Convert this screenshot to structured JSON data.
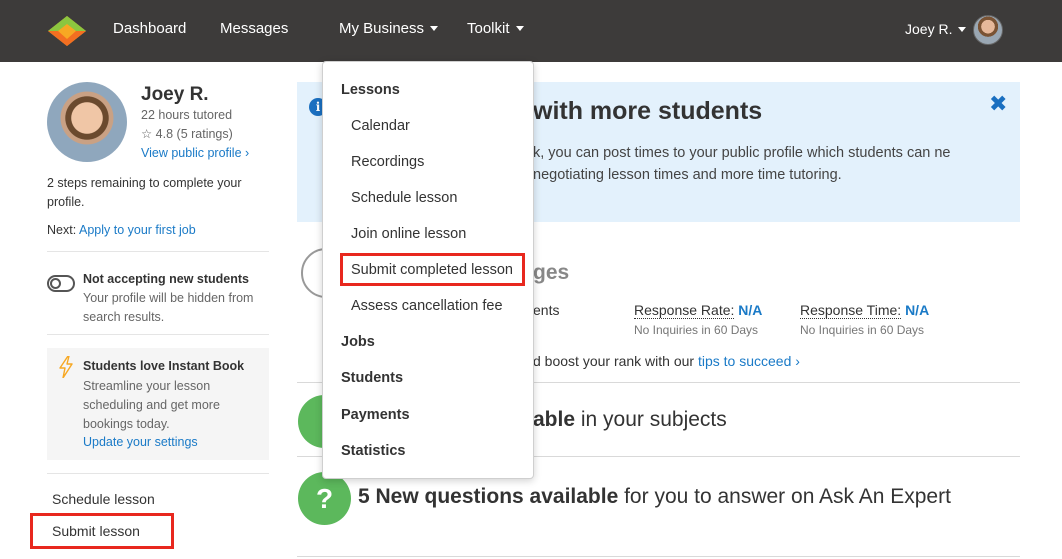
{
  "nav": {
    "items": [
      "Dashboard",
      "Messages",
      "My Business",
      "Toolkit"
    ],
    "user": "Joey R.",
    "bg_color": "#3d3b3a"
  },
  "profile": {
    "name": "Joey R.",
    "hours": "22 hours tutored",
    "rating": "☆ 4.8 (5 ratings)",
    "view_link": "View public profile ›",
    "steps": "2 steps remaining to complete your profile.",
    "next_label": "Next:",
    "next_link": "Apply to your first job"
  },
  "availability": {
    "title": "Not accepting new students",
    "subtitle": "Your profile will be hidden from search results."
  },
  "instant_book": {
    "title": "Students love Instant Book",
    "text": "Streamline your lesson scheduling and get more bookings today.",
    "link": "Update your settings"
  },
  "sidebar_links": [
    "Schedule lesson",
    "Submit lesson"
  ],
  "banner": {
    "title": "with more students",
    "text": "k, you can post times to your public profile which students can ne negotiating lesson times and more time tutoring.",
    "close": "✖"
  },
  "messages": {
    "title": "ges",
    "partial_label": "ents",
    "response_rate_label": "Response Rate:",
    "response_rate_value": "N/A",
    "response_rate_sub": "No Inquiries in 60 Days",
    "response_time_label": "Response Time:",
    "response_time_value": "N/A",
    "response_time_sub": "No Inquiries in 60 Days",
    "boost_text": "d boost your rank with our ",
    "boost_link": "tips to succeed ›"
  },
  "jobs": {
    "bold": "able",
    "rest": " in your subjects"
  },
  "questions": {
    "bold": "5 New questions available",
    "rest": " for you to answer on Ask An Expert",
    "icon": "?"
  },
  "dropdown": {
    "lessons_header": "Lessons",
    "lesson_items": [
      "Calendar",
      "Recordings",
      "Schedule lesson",
      "Join online lesson",
      "Submit completed lesson",
      "Assess cancellation fee"
    ],
    "other_headers": [
      "Jobs",
      "Students",
      "Payments",
      "Statistics"
    ]
  },
  "colors": {
    "link": "#1a7ac7",
    "highlight": "#e8281e",
    "banner_bg": "#e3f1fc",
    "green": "#5cb85c"
  }
}
